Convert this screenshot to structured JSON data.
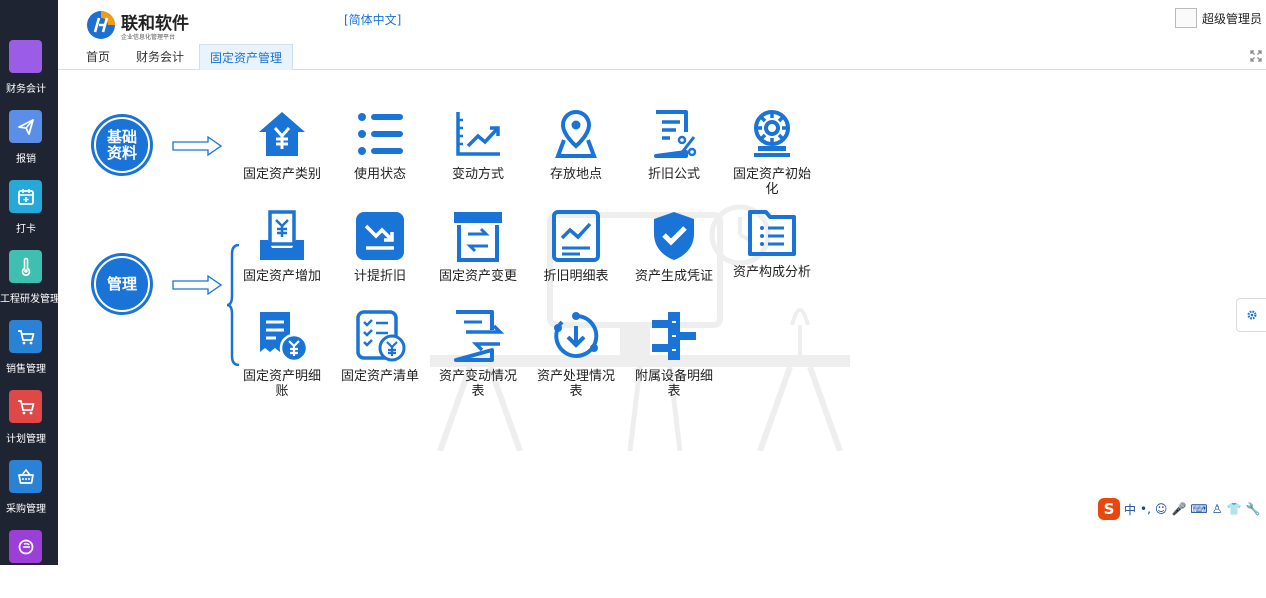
{
  "header": {
    "brand": "联和软件",
    "brand_sub": "企业信息化管理平台",
    "language": "[简体中文]",
    "user": "超级管理员"
  },
  "tabs": [
    {
      "label": "首页",
      "active": false
    },
    {
      "label": "财务会计",
      "active": false
    },
    {
      "label": "固定资产管理",
      "active": true
    }
  ],
  "sidebar": {
    "items": [
      {
        "label": "财务会计",
        "color": "#9b5de5",
        "icon": "purple-square-icon"
      },
      {
        "label": "报销",
        "color": "#5b8ee6",
        "icon": "paper-plane-icon"
      },
      {
        "label": "打卡",
        "color": "#26a8d8",
        "icon": "calendar-plus-icon"
      },
      {
        "label": "工程研发管理",
        "color": "#3fbfb0",
        "icon": "thermometer-icon"
      },
      {
        "label": "销售管理",
        "color": "#2a82d6",
        "icon": "cart-icon"
      },
      {
        "label": "计划管理",
        "color": "#e04848",
        "icon": "cart-icon"
      },
      {
        "label": "采购管理",
        "color": "#2a82d6",
        "icon": "basket-icon"
      },
      {
        "label": "",
        "color": "#9b3fd6",
        "icon": "ring-icon"
      }
    ]
  },
  "sections": {
    "basic": {
      "title_line1": "基础",
      "title_line2": "资料"
    },
    "manage": {
      "title": "管理"
    }
  },
  "functions": {
    "row1": [
      {
        "label": "固定资产类别",
        "icon": "house-yen-icon"
      },
      {
        "label": "使用状态",
        "icon": "list-icon"
      },
      {
        "label": "变动方式",
        "icon": "trend-chart-icon"
      },
      {
        "label": "存放地点",
        "icon": "location-pin-icon"
      },
      {
        "label": "折旧公式",
        "icon": "document-percent-icon"
      },
      {
        "label": "固定资产初始化",
        "icon": "gear-stamp-icon"
      }
    ],
    "row2": [
      {
        "label": "固定资产增加",
        "icon": "receipt-tray-icon"
      },
      {
        "label": "计提折旧",
        "icon": "downtrend-icon"
      },
      {
        "label": "固定资产变更",
        "icon": "box-swap-icon"
      },
      {
        "label": "折旧明细表",
        "icon": "chart-document-icon"
      },
      {
        "label": "资产生成凭证",
        "icon": "shield-check-icon"
      },
      {
        "label": "资产构成分析",
        "icon": "folder-list-icon"
      }
    ],
    "row3": [
      {
        "label": "固定资产明细账",
        "icon": "receipt-yen-icon"
      },
      {
        "label": "固定资产清单",
        "icon": "checklist-yen-icon"
      },
      {
        "label": "资产变动情况表",
        "icon": "document-arrows-icon"
      },
      {
        "label": "资产处理情况表",
        "icon": "cycle-download-icon"
      },
      {
        "label": "附属设备明细表",
        "icon": "equipment-icon"
      }
    ]
  },
  "ime": {
    "logo": "S",
    "mode": "中"
  },
  "accent": "#1a73d6"
}
